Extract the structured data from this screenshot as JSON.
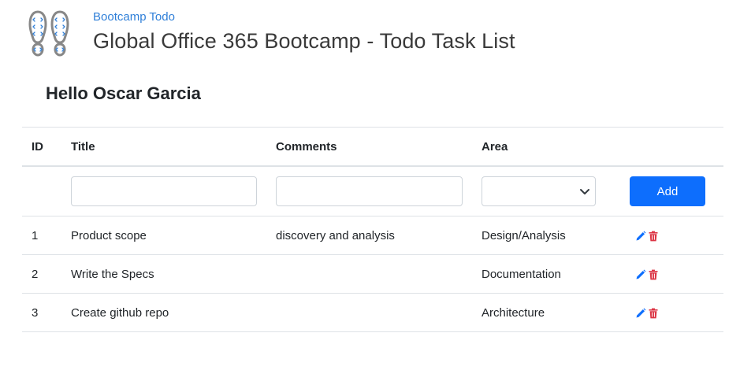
{
  "header": {
    "brand_link": "Bootcamp Todo",
    "title": "Global Office 365 Bootcamp - Todo Task List",
    "logo_icon": "footprints-icon"
  },
  "greeting": "Hello Oscar Garcia",
  "table": {
    "columns": {
      "id": "ID",
      "title": "Title",
      "comments": "Comments",
      "area": "Area"
    },
    "new_task": {
      "title_value": "",
      "comments_value": "",
      "area_selected": "",
      "add_label": "Add"
    },
    "rows": [
      {
        "id": "1",
        "title": "Product scope",
        "comments": "discovery and analysis",
        "area": "Design/Analysis"
      },
      {
        "id": "2",
        "title": "Write the Specs",
        "comments": "",
        "area": "Documentation"
      },
      {
        "id": "3",
        "title": "Create github repo",
        "comments": "",
        "area": "Architecture"
      }
    ],
    "row_actions": {
      "edit_icon": "pencil-icon",
      "delete_icon": "trash-icon"
    }
  },
  "colors": {
    "link": "#2f7fd8",
    "primary_button": "#0d6efd",
    "edit_icon": "#0d6efd",
    "delete_icon": "#dc3545"
  }
}
